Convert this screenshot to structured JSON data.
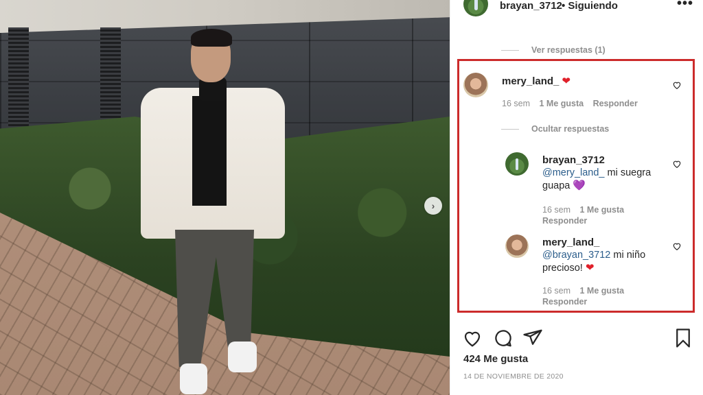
{
  "header": {
    "username": "brayan_3712",
    "follow_label": "• Siguiendo",
    "more_label": "•••"
  },
  "view_replies": "Ver respuestas (1)",
  "hide_replies": "Ocultar respuestas",
  "main_comment": {
    "username": "mery_land_",
    "emoji": "❤",
    "time": "16 sem",
    "likes": "1 Me gusta",
    "reply": "Responder"
  },
  "replies": [
    {
      "username": "brayan_3712",
      "mention": "@mery_land_",
      "text": " mi suegra guapa ",
      "emoji": "💜",
      "time": "16 sem",
      "likes": "1 Me gusta",
      "reply": "Responder"
    },
    {
      "username": "mery_land_",
      "mention": "@brayan_3712",
      "text": " mi niño precioso! ",
      "emoji": "❤",
      "time": "16 sem",
      "likes": "1 Me gusta",
      "reply": "Responder"
    }
  ],
  "post": {
    "likes": "424 Me gusta",
    "date": "14 DE NOVIEMBRE DE 2020"
  },
  "colors": {
    "highlight_border": "#cc2b2b",
    "heart_red": "#e0202a",
    "heart_purple": "#8b5cf6",
    "mention": "#2b5d8b",
    "muted": "#8e8e8e"
  },
  "icons": [
    "heart-icon",
    "comment-icon",
    "share-icon",
    "bookmark-icon",
    "more-icon",
    "chevron-right-icon"
  ]
}
